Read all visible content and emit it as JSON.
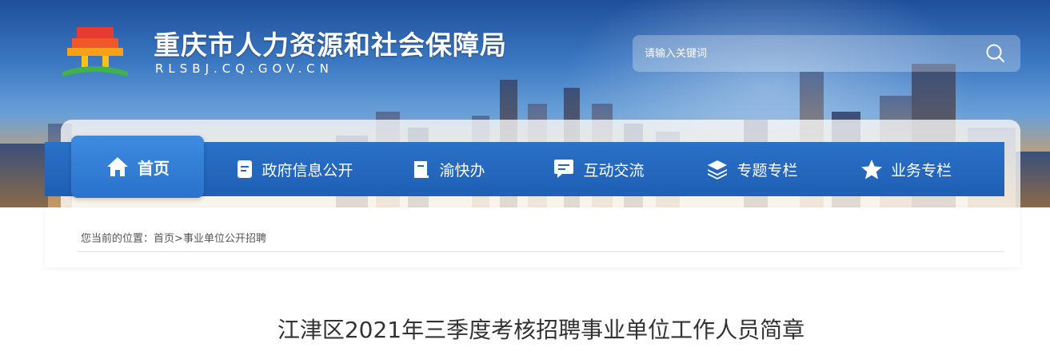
{
  "header": {
    "site_title": "重庆市人力资源和社会保障局",
    "site_domain": "RLSBJ.CQ.GOV.CN",
    "logo_icon": "building-logo-icon"
  },
  "search": {
    "placeholder": "请输入关键词",
    "button_icon": "search-icon"
  },
  "nav": {
    "items": [
      {
        "label": "首页",
        "icon": "home-icon",
        "active": true
      },
      {
        "label": "政府信息公开",
        "icon": "document-icon"
      },
      {
        "label": "渝快办",
        "icon": "book-icon"
      },
      {
        "label": "互动交流",
        "icon": "chat-icon"
      },
      {
        "label": "专题专栏",
        "icon": "layers-icon"
      },
      {
        "label": "业务专栏",
        "icon": "star-icon"
      }
    ]
  },
  "breadcrumb": {
    "prefix": "您当前的位置：",
    "home": "首页",
    "separator": ">",
    "current": "事业单位公开招聘"
  },
  "article": {
    "title": "江津区2021年三季度考核招聘事业单位工作人员简章"
  },
  "colors": {
    "nav_blue": "#1f5fb4",
    "nav_active": "#3d8be0",
    "title_text": "#333333"
  }
}
